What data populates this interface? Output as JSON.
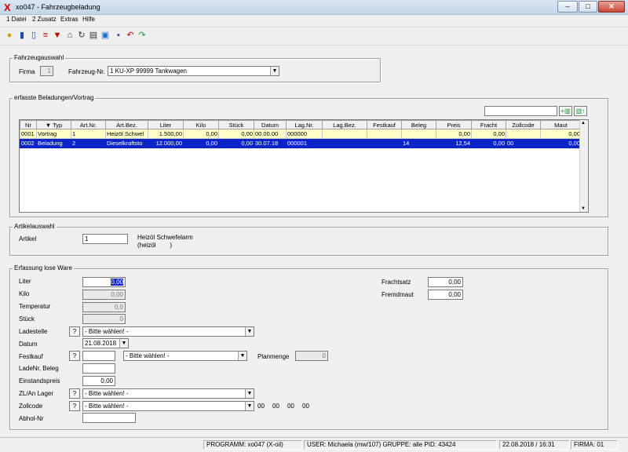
{
  "window": {
    "title": "xo047 - Fahrzeugbeladung",
    "app_glyph": "X",
    "min": "–",
    "max": "□",
    "close": "✕"
  },
  "menu": [
    "1 Datei",
    "2 Zusatz",
    "Extras",
    "Hilfe"
  ],
  "toolbar_icons": [
    "lightbulb-icon",
    "book-icon",
    "open-book-icon",
    "stack-icon",
    "filter-icon",
    "home-icon",
    "refresh-icon",
    "print-icon",
    "screen-icon",
    "save-icon",
    "undo-icon",
    "redo-icon"
  ],
  "vehicle": {
    "group_label": "Fahrzeugauswahl",
    "firma_label": "Firma",
    "firma_value": "1",
    "fahrzeug_label": "Fahrzeug-Nr.",
    "fahrzeug_value": "1  KU-XP 99999  Tankwagen"
  },
  "loads": {
    "group_label": "erfasste Beladungen/Vortrag",
    "columns": [
      "Nr",
      "Typ",
      "Art.Nr.",
      "Art.Bez.",
      "Liter",
      "Kilo",
      "Stück",
      "Datum",
      "Lag.Nr.",
      "Lag.Bez.",
      "Festkauf",
      "Beleg",
      "Preis",
      "Fracht",
      "Zollcode",
      "Maut"
    ],
    "rows": [
      [
        "0001",
        "Vortrag",
        "1",
        "Heizöl Schwel",
        "1.500,00",
        "0,00",
        "0,00",
        "00.00.00",
        "000000",
        "",
        "",
        "",
        "0,00",
        "0,00",
        "",
        "0,00"
      ],
      [
        "0002",
        "Beladung",
        "2",
        "Dieselkraftsto",
        "12.000,00",
        "0,00",
        "0,00",
        "30.07.18",
        "000001",
        "",
        "",
        "14",
        "12,54",
        "0,00",
        "00",
        "0,00"
      ]
    ],
    "search_value": ""
  },
  "article": {
    "group_label": "Artikelauswahl",
    "label": "Artikel",
    "value": "1",
    "desc_line1": "Heizöl Schwefelarm",
    "desc_line2": "(heizöl        )"
  },
  "entry": {
    "group_label": "Erfassung  lose Ware",
    "liter_label": "Liter",
    "liter_value": "0,00",
    "kilo_label": "Kilo",
    "kilo_value": "0,00",
    "temp_label": "Temperatur",
    "temp_value": "0,0",
    "stueck_label": "Stück",
    "stueck_value": "0",
    "ladestelle_label": "Ladestelle",
    "ladestelle_value": "- Bitte wählen! -",
    "datum_label": "Datum",
    "datum_value": "21.08.2018",
    "festkauf_label": "Festkauf",
    "festkauf_value": "",
    "festkauf_select": "- Bitte wählen! -",
    "planmenge_label": "Planmenge",
    "planmenge_value": "0",
    "ladenr_label": "LadeNr, Beleg",
    "ladenr_value": "",
    "einstand_label": "Einstandspreis",
    "einstand_value": "0,00",
    "zllager_label": "ZL/An Lager",
    "zllager_value": "- Bitte wählen! -",
    "zollcode_label": "Zollcode",
    "zollcode_value": "- Bitte wählen! -",
    "zollcode_codes": [
      "00",
      "00",
      "00",
      "00"
    ],
    "abhol_label": "Abhol-Nr",
    "abhol_value": "",
    "frachtsatz_label": "Frachtsatz",
    "frachtsatz_value": "0,00",
    "fremdmaut_label": "Fremdmaut",
    "fremdmaut_value": "0,00",
    "help": "?"
  },
  "status": {
    "programm": "PROGRAMM: xo047 (X-oil)",
    "user": "USER: Michaela (mw/107)  GRUPPE: alle  PID: 43424",
    "datetime": "22.08.2018 / 16:31",
    "firma": "FIRMA: 01"
  }
}
